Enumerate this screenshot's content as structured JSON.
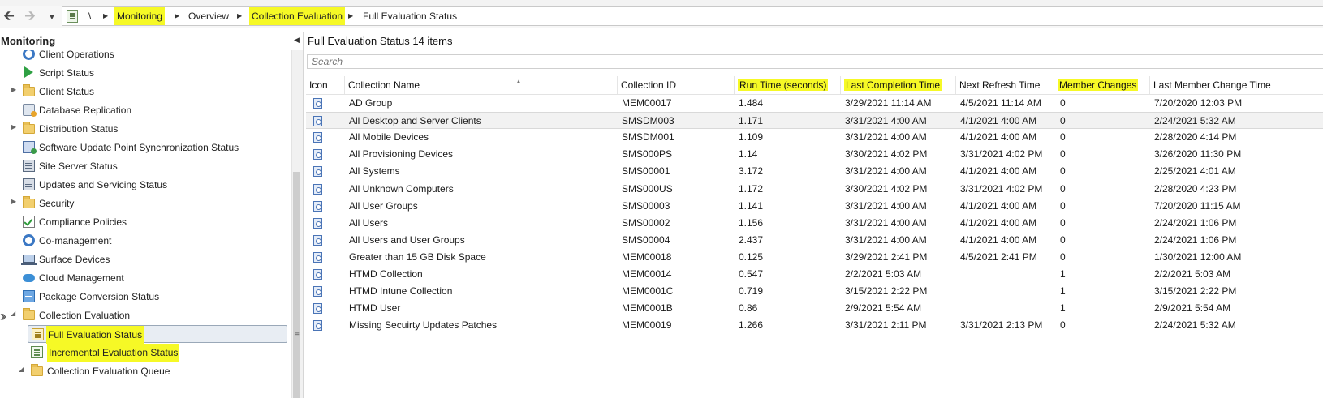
{
  "breadcrumb": {
    "root": "\\",
    "items": [
      "Monitoring",
      "Overview",
      "Collection Evaluation",
      "Full Evaluation Status"
    ]
  },
  "left_pane": {
    "title": "Monitoring",
    "tree": [
      {
        "label": "Client Operations",
        "icon": "gear-icon"
      },
      {
        "label": "Script Status",
        "icon": "play-icon"
      },
      {
        "label": "Client Status",
        "icon": "folder-icon"
      },
      {
        "label": "Database Replication",
        "icon": "database-icon"
      },
      {
        "label": "Distribution Status",
        "icon": "folder-icon"
      },
      {
        "label": "Software Update Point Synchronization Status",
        "icon": "update-icon"
      },
      {
        "label": "Site Server Status",
        "icon": "server-icon"
      },
      {
        "label": "Updates and Servicing Status",
        "icon": "server-icon"
      },
      {
        "label": "Security",
        "icon": "folder-icon"
      },
      {
        "label": "Compliance Policies",
        "icon": "checkmark-icon"
      },
      {
        "label": "Co-management",
        "icon": "gear-icon"
      },
      {
        "label": "Surface Devices",
        "icon": "laptop-icon"
      },
      {
        "label": "Cloud Management",
        "icon": "cloud-icon"
      },
      {
        "label": "Package Conversion Status",
        "icon": "package-icon"
      },
      {
        "label": "Collection Evaluation",
        "icon": "folder-icon"
      },
      {
        "label": "Full Evaluation Status",
        "icon": "report-icon"
      },
      {
        "label": "Incremental Evaluation Status",
        "icon": "report-icon"
      },
      {
        "label": "Collection Evaluation Queue",
        "icon": "folder-icon"
      }
    ]
  },
  "main": {
    "title": "Full Evaluation Status",
    "count": "14 items",
    "search_placeholder": "Search",
    "columns": [
      "Icon",
      "Collection Name",
      "Collection ID",
      "Run Time (seconds)",
      "Last Completion Time",
      "Next Refresh Time",
      "Member Changes",
      "Last Member Change Time"
    ],
    "rows": [
      [
        "AD Group",
        "MEM00017",
        "1.484",
        "3/29/2021 11:14 AM",
        "4/5/2021 11:14 AM",
        "0",
        "7/20/2020 12:03 PM"
      ],
      [
        "All Desktop and Server Clients",
        "SMSDM003",
        "1.171",
        "3/31/2021 4:00 AM",
        "4/1/2021 4:00 AM",
        "0",
        "2/24/2021 5:32 AM"
      ],
      [
        "All Mobile Devices",
        "SMSDM001",
        "1.109",
        "3/31/2021 4:00 AM",
        "4/1/2021 4:00 AM",
        "0",
        "2/28/2020 4:14 PM"
      ],
      [
        "All Provisioning Devices",
        "SMS000PS",
        "1.14",
        "3/30/2021 4:02 PM",
        "3/31/2021 4:02 PM",
        "0",
        "3/26/2020 11:30 PM"
      ],
      [
        "All Systems",
        "SMS00001",
        "3.172",
        "3/31/2021 4:00 AM",
        "4/1/2021 4:00 AM",
        "0",
        "2/25/2021 4:01 AM"
      ],
      [
        "All Unknown Computers",
        "SMS000US",
        "1.172",
        "3/30/2021 4:02 PM",
        "3/31/2021 4:02 PM",
        "0",
        "2/28/2020 4:23 PM"
      ],
      [
        "All User Groups",
        "SMS00003",
        "1.141",
        "3/31/2021 4:00 AM",
        "4/1/2021 4:00 AM",
        "0",
        "7/20/2020 11:15 AM"
      ],
      [
        "All Users",
        "SMS00002",
        "1.156",
        "3/31/2021 4:00 AM",
        "4/1/2021 4:00 AM",
        "0",
        "2/24/2021 1:06 PM"
      ],
      [
        "All Users and User Groups",
        "SMS00004",
        "2.437",
        "3/31/2021 4:00 AM",
        "4/1/2021 4:00 AM",
        "0",
        "2/24/2021 1:06 PM"
      ],
      [
        "Greater than 15 GB Disk Space",
        "MEM00018",
        "0.125",
        "3/29/2021 2:41 PM",
        "4/5/2021 2:41 PM",
        "0",
        "1/30/2021 12:00 AM"
      ],
      [
        "HTMD Collection",
        "MEM00014",
        "0.547",
        "2/2/2021 5:03 AM",
        "",
        "1",
        "2/2/2021 5:03 AM"
      ],
      [
        "HTMD Intune Collection",
        "MEM0001C",
        "0.719",
        "3/15/2021 2:22 PM",
        "",
        "1",
        "3/15/2021 2:22 PM"
      ],
      [
        "HTMD User",
        "MEM0001B",
        "0.86",
        "2/9/2021 5:54 AM",
        "",
        "1",
        "2/9/2021 5:54 AM"
      ],
      [
        "Missing Secuirty Updates Patches",
        "MEM00019",
        "1.266",
        "3/31/2021 2:11 PM",
        "3/31/2021 2:13 PM",
        "0",
        "2/24/2021 5:32 AM"
      ]
    ]
  },
  "colors": {
    "highlight": "#f6f926",
    "selection": "#e8edf3"
  }
}
